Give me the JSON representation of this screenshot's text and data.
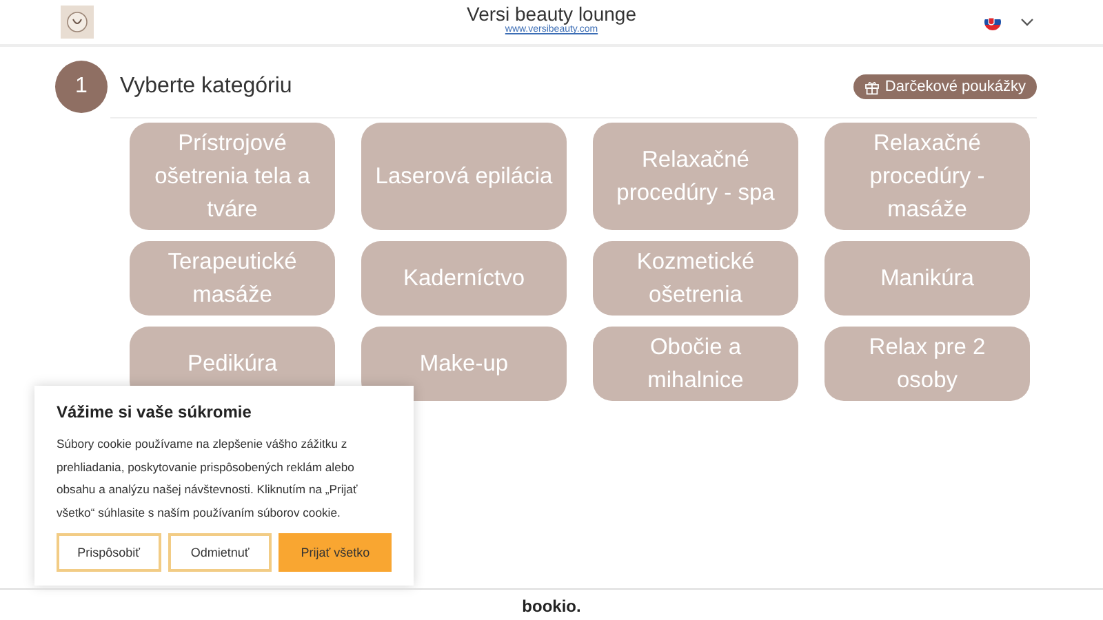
{
  "header": {
    "title": "Versi beauty lounge",
    "website": "www.versibeauty.com"
  },
  "step": {
    "number": "1",
    "title": "Vyberte kategóriu",
    "voucher_button": "Darčekové poukážky"
  },
  "categories": [
    "Prístrojové ošetrenia tela a tváre",
    "Laserová epilácia",
    "Relaxačné procedúry - spa",
    "Relaxačné procedúry - masáže",
    "Terapeutické masáže",
    "Kaderníctvo",
    "Kozmetické ošetrenia",
    "Manikúra",
    "Pedikúra",
    "Make-up",
    "Obočie a mihalnice",
    "Relax pre 2 osoby"
  ],
  "cookie_banner": {
    "title": "Vážime si vaše súkromie",
    "text": "Súbory cookie používame na zlepšenie vášho zážitku z prehliadania, poskytovanie prispôsobených reklám alebo obsahu a analýzu našej návštevnosti. Kliknutím na „Prijať všetko“ súhlasite s naším používaním súborov cookie.",
    "buttons": [
      {
        "label": "Prispôsobiť",
        "kind": "outline"
      },
      {
        "label": "Odmietnuť",
        "kind": "outline"
      },
      {
        "label": "Prijať všetko",
        "kind": "primary"
      }
    ]
  },
  "footer": {
    "brand": "bookio."
  }
}
